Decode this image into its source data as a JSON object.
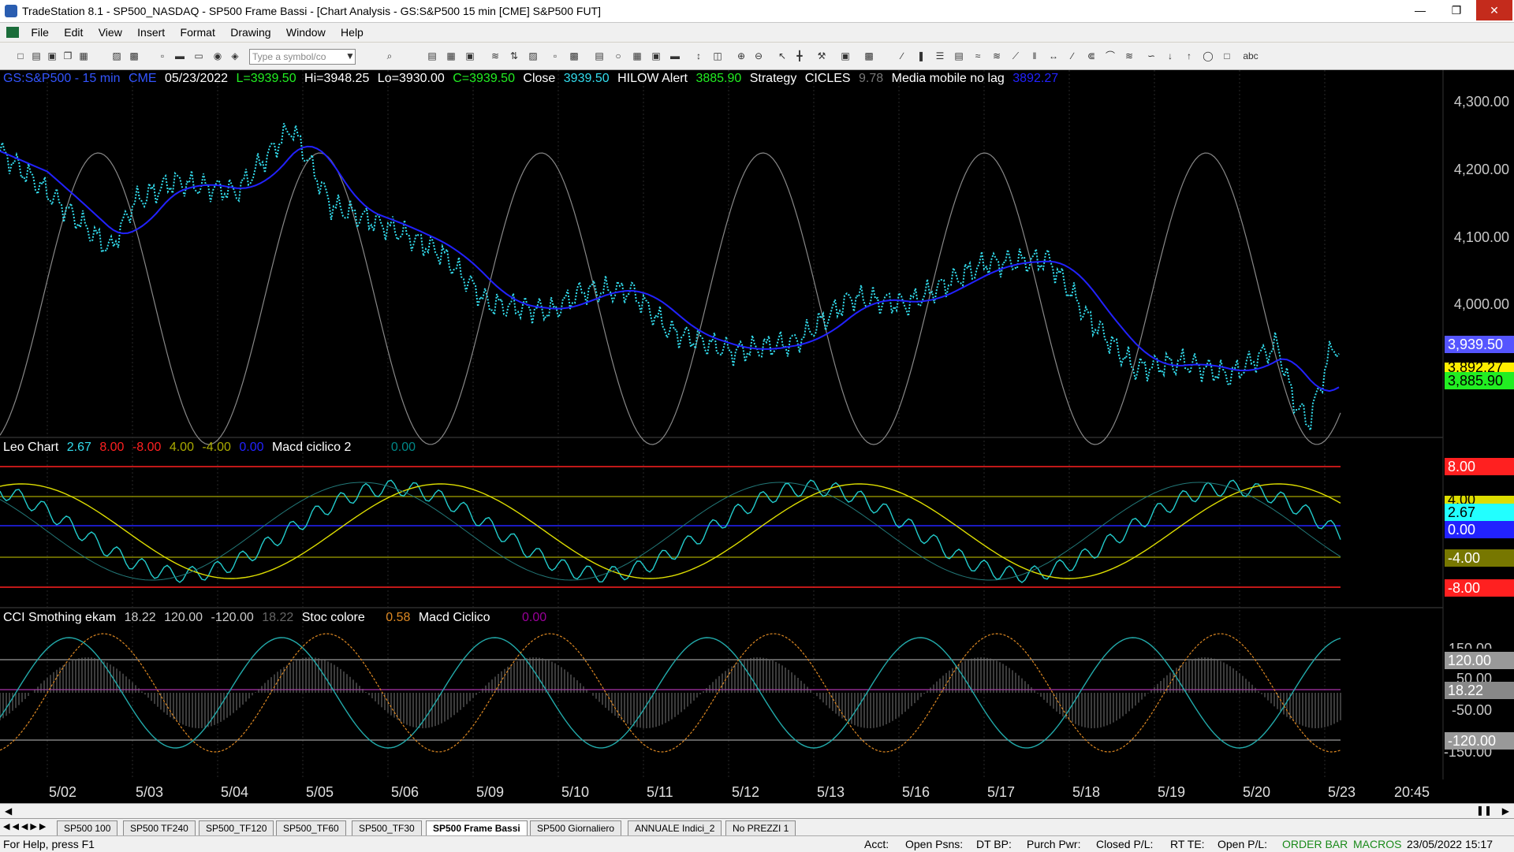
{
  "window": {
    "title": "TradeStation 8.1 - SP500_NASDAQ - SP500 Frame Bassi - [Chart Analysis - GS:S&P500  15 min  [CME] S&P500 FUT]"
  },
  "menu": [
    "File",
    "Edit",
    "View",
    "Insert",
    "Format",
    "Drawing",
    "Window",
    "Help"
  ],
  "toolbar": {
    "symbol_placeholder": "Type a symbol/co",
    "text_tool": "abc"
  },
  "price_header": {
    "symbol": "GS:S&P500 - 15 min",
    "exchange": "CME",
    "date": "05/23/2022",
    "last": "L=3939.50",
    "high": "Hi=3948.25",
    "low": "Lo=3930.00",
    "close_val": "C=3939.50",
    "close_label": "Close",
    "close_value": "3939.50",
    "hilow_label": "HILOW Alert",
    "hilow_value": "3885.90",
    "strategy_label": "Strategy",
    "cicles_label": "CICLES",
    "cicles_value": "9.78",
    "mm_label": "Media mobile no lag",
    "mm_value": "3892.27"
  },
  "leo_header": {
    "label": "Leo Chart",
    "v1": "2.67",
    "v2": "8.00",
    "v3": "-8.00",
    "v4": "4.00",
    "v5": "-4.00",
    "v6": "0.00",
    "macd_label": "Macd ciclico 2",
    "macd_value": "0.00"
  },
  "cci_header": {
    "label": "CCI Smothing ekam",
    "v1": "18.22",
    "v2": "120.00",
    "v3": "-120.00",
    "v4": "18.22",
    "stoc_label": "Stoc colore",
    "stoc_value": "0.58",
    "macd_label": "Macd Ciclico",
    "macd_value": "0.00"
  },
  "price_axis": [
    "4,300.00",
    "4,200.00",
    "4,100.00",
    "4,000.00"
  ],
  "price_tags": {
    "close": "3,939.50",
    "mm": "3,892.27",
    "hilow": "3,885.90"
  },
  "leo_axis_tags": [
    "8.00",
    "4.00",
    "2.67",
    "0.00",
    "-4.00",
    "-8.00"
  ],
  "cci_axis_tags": [
    "150.00",
    "120.00",
    "50.00",
    "18.22",
    "-50.00",
    "-120.00",
    "-150.00"
  ],
  "date_axis": [
    "5/02",
    "5/03",
    "5/04",
    "5/05",
    "5/06",
    "5/09",
    "5/10",
    "5/11",
    "5/12",
    "5/13",
    "5/16",
    "5/17",
    "5/18",
    "5/19",
    "5/20",
    "5/23",
    "20:45"
  ],
  "tabs": [
    "SP500 100",
    "SP500 TF240",
    "SP500_TF120",
    "SP500_TF60",
    "SP500_TF30",
    "SP500 Frame Bassi",
    "SP500 Giornaliero",
    "ANNUALE Indici_2",
    "No PREZZI 1"
  ],
  "active_tab": "SP500 Frame Bassi",
  "status": {
    "help": "For Help, press F1",
    "acct": "Acct:",
    "open_psns": "Open Psns:",
    "dt_bp": "DT BP:",
    "purch_pwr": "Purch Pwr:",
    "closed_pl": "Closed P/L:",
    "rt_te": "RT TE:",
    "open_pl": "Open P/L:",
    "order_bar": "ORDER BAR",
    "macros": "MACROS",
    "datetime": "23/05/2022 15:17"
  },
  "colors": {
    "bg": "#000000",
    "price_dots": "#33ddee",
    "ma_red": "#ff2020",
    "ma_green": "#22ee22",
    "blue": "#2222ff",
    "yellow": "#dddd00"
  }
}
